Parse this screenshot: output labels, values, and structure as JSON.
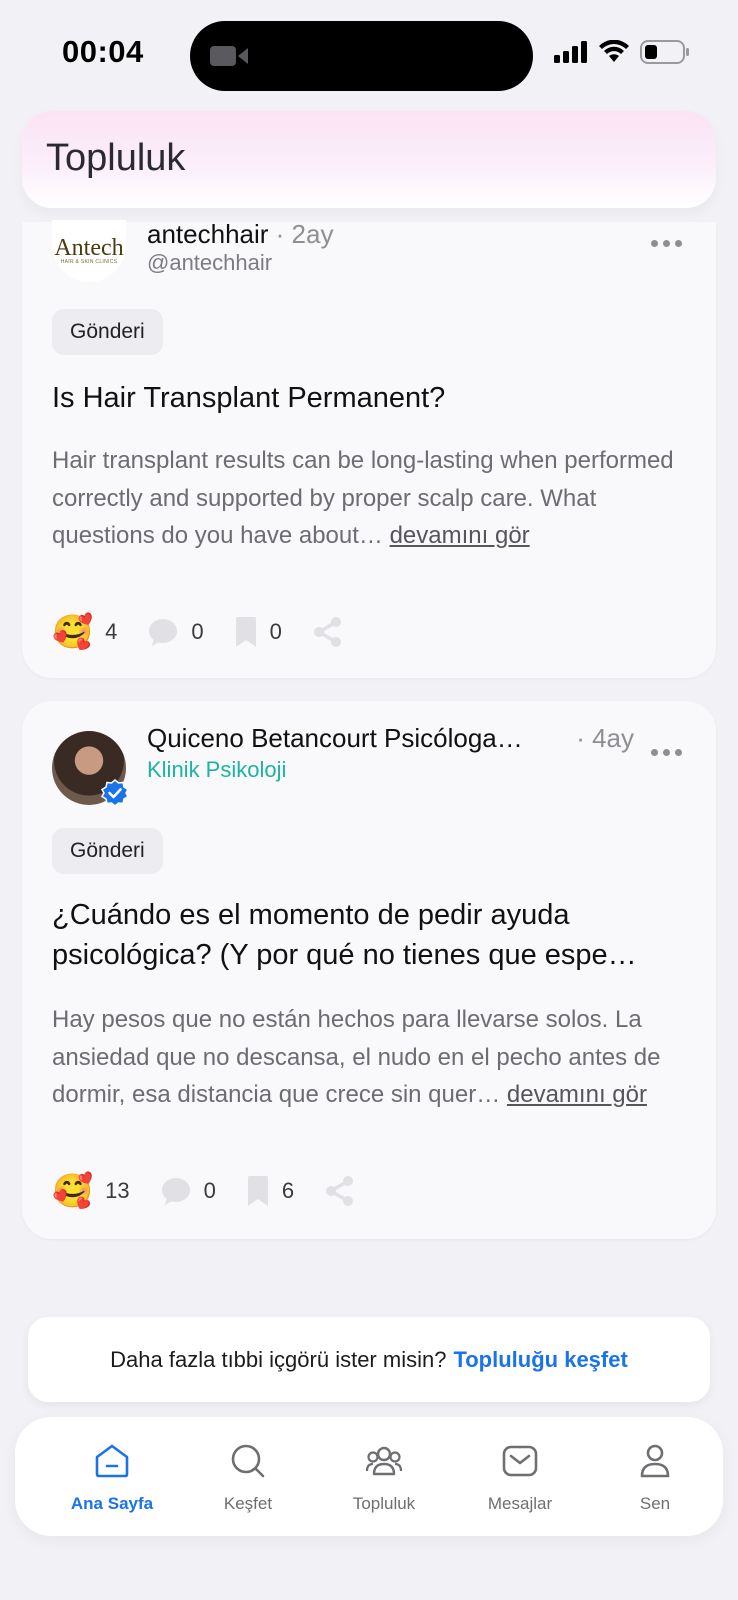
{
  "status": {
    "time": "00:04"
  },
  "header": {
    "title": "Topluluk"
  },
  "posts": [
    {
      "author": "antechhair",
      "time_ago": "· 2ay",
      "handle": "@antechhair",
      "logo_word": "Antech",
      "logo_sub": "HAIR & SKIN CLINICS",
      "tag": "Gönderi",
      "title": "Is Hair Transplant Permanent?",
      "body": "Hair transplant results can be long-lasting when performed correctly and supported by proper scalp care. What questions do you have about…",
      "see_more": "devamını gör",
      "reaction_emoji": "🥰",
      "reactions": "4",
      "comments": "0",
      "saves": "0"
    },
    {
      "author": "Quiceno Betancourt Psicóloga…",
      "time_ago": "· 4ay",
      "specialty": "Klinik Psikoloji",
      "tag": "Gönderi",
      "title": "¿Cuándo es el momento de pedir ayuda psicológica? (Y por qué no tienes que espe…",
      "body": "Hay pesos que no están hechos para llevarse solos. La ansiedad que no descansa, el nudo en el pecho antes de dormir, esa distancia que crece sin quer…",
      "see_more": "devamını gör",
      "reaction_emoji": "🥰",
      "reactions": "13",
      "comments": "0",
      "saves": "6"
    }
  ],
  "cta": {
    "text": "Daha fazla tıbbi içgörü ister misin?",
    "link": "Topluluğu keşfet"
  },
  "tabs": [
    {
      "label": "Ana Sayfa",
      "icon": "home-icon",
      "active": true
    },
    {
      "label": "Keşfet",
      "icon": "search-icon",
      "active": false
    },
    {
      "label": "Topluluk",
      "icon": "community-icon",
      "active": false
    },
    {
      "label": "Mesajlar",
      "icon": "mail-icon",
      "active": false
    },
    {
      "label": "Sen",
      "icon": "profile-icon",
      "active": false
    }
  ],
  "colors": {
    "accent": "#1a73e8",
    "specialty": "#1db3a0",
    "header_tint": "#fbe3f5"
  }
}
